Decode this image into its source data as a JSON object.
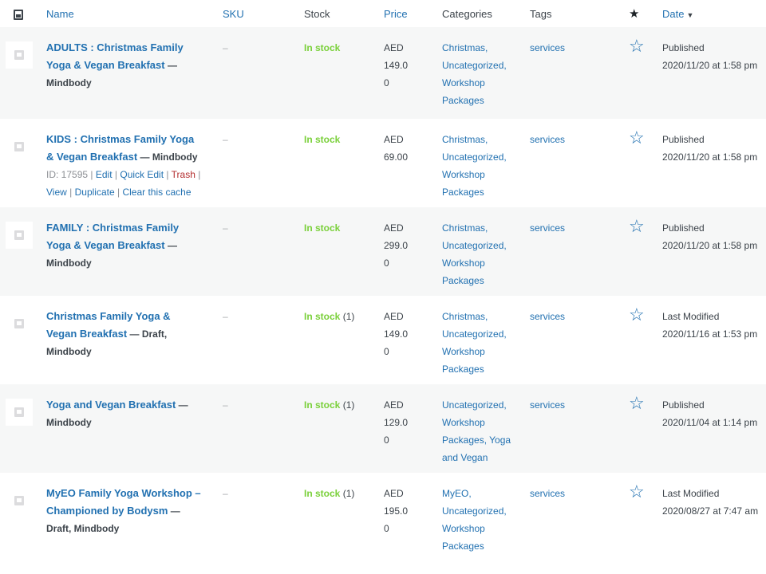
{
  "header": {
    "name": "Name",
    "sku": "SKU",
    "stock": "Stock",
    "price": "Price",
    "categories": "Categories",
    "tags": "Tags",
    "featured_glyph": "★",
    "date": "Date",
    "date_sort_glyph": "▼"
  },
  "rows": [
    {
      "name": "ADULTS : Christmas Family Yoga & Vegan Breakfast",
      "state": "— Mindbody",
      "sku": "–",
      "stock": "In stock",
      "stock_count": "",
      "price_line1": "AED 149.0",
      "price_line2": "0",
      "categories": "Christmas, Uncategorized, Workshop Packages",
      "tags": "services",
      "date_status": "Published",
      "date_when": "2020/11/20 at 1:58 pm"
    },
    {
      "name": "KIDS : Christmas Family Yoga & Vegan Breakfast",
      "state": "— Mindbody",
      "sku": "–",
      "stock": "In stock",
      "stock_count": "",
      "price_line1": "AED 69.00",
      "price_line2": "",
      "categories": "Christmas, Uncategorized, Workshop Packages",
      "tags": "services",
      "date_status": "Published",
      "date_when": "2020/11/20 at 1:58 pm",
      "actions": {
        "id": "ID: 17595",
        "sep": "|",
        "edit": "Edit",
        "quick_edit": "Quick Edit",
        "trash": "Trash",
        "view": "View",
        "duplicate": "Duplicate",
        "clear_cache": "Clear this cache"
      }
    },
    {
      "name": "FAMILY : Christmas Family Yoga & Vegan Breakfast",
      "state": "— Mindbody",
      "sku": "–",
      "stock": "In stock",
      "stock_count": "",
      "price_line1": "AED 299.0",
      "price_line2": "0",
      "categories": "Christmas, Uncategorized, Workshop Packages",
      "tags": "services",
      "date_status": "Published",
      "date_when": "2020/11/20 at 1:58 pm"
    },
    {
      "name": "Christmas Family Yoga & Vegan Breakfast",
      "state": "— Draft, Mindbody",
      "sku": "–",
      "stock": "In stock",
      "stock_count": "(1)",
      "price_line1": "AED 149.0",
      "price_line2": "0",
      "categories": "Christmas, Uncategorized, Workshop Packages",
      "tags": "services",
      "date_status": "Last Modified",
      "date_when": "2020/11/16 at 1:53 pm"
    },
    {
      "name": "Yoga and Vegan Breakfast",
      "state": "— Mindbody",
      "sku": "–",
      "stock": "In stock",
      "stock_count": "(1)",
      "price_line1": "AED 129.0",
      "price_line2": "0",
      "categories": "Uncategorized, Workshop Packages, Yoga and Vegan",
      "tags": "services",
      "date_status": "Published",
      "date_when": "2020/11/04 at 1:14 pm"
    },
    {
      "name": "MyEO Family Yoga Workshop – Championed by Bodysm",
      "state": "— Draft, Mindbody",
      "sku": "–",
      "stock": "In stock",
      "stock_count": "(1)",
      "price_line1": "AED 195.0",
      "price_line2": "0",
      "categories": "MyEO, Uncategorized, Workshop Packages",
      "tags": "services",
      "date_status": "Last Modified",
      "date_when": "2020/08/27 at 7:47 am"
    }
  ],
  "featured_star_glyph": "☆",
  "colors": {
    "link": "#2271b1",
    "in_stock": "#7ad03a",
    "trash": "#b32d2e",
    "alt_row": "#f6f7f7"
  }
}
